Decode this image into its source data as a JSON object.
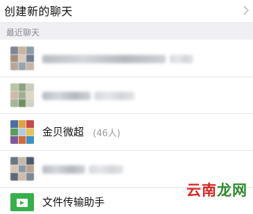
{
  "create_chat": {
    "label": "创建新的聊天"
  },
  "recent": {
    "header": "最近聊天"
  },
  "chats": [
    {
      "name": "",
      "count": "",
      "blurred": true
    },
    {
      "name": "",
      "count": "",
      "blurred": true
    },
    {
      "name": "金贝微超",
      "count": "(46人)",
      "blurred": false
    },
    {
      "name": "",
      "count": "",
      "blurred": true
    }
  ],
  "file_helper": {
    "name": "文件传输助手"
  },
  "watermark": {
    "part1": "云南",
    "part2": "龙网"
  },
  "colors": {
    "section_bg": "#efeff4",
    "file_icon": "#36b04a",
    "watermark_red": "#d8261f",
    "watermark_green": "#2b8a2b"
  }
}
